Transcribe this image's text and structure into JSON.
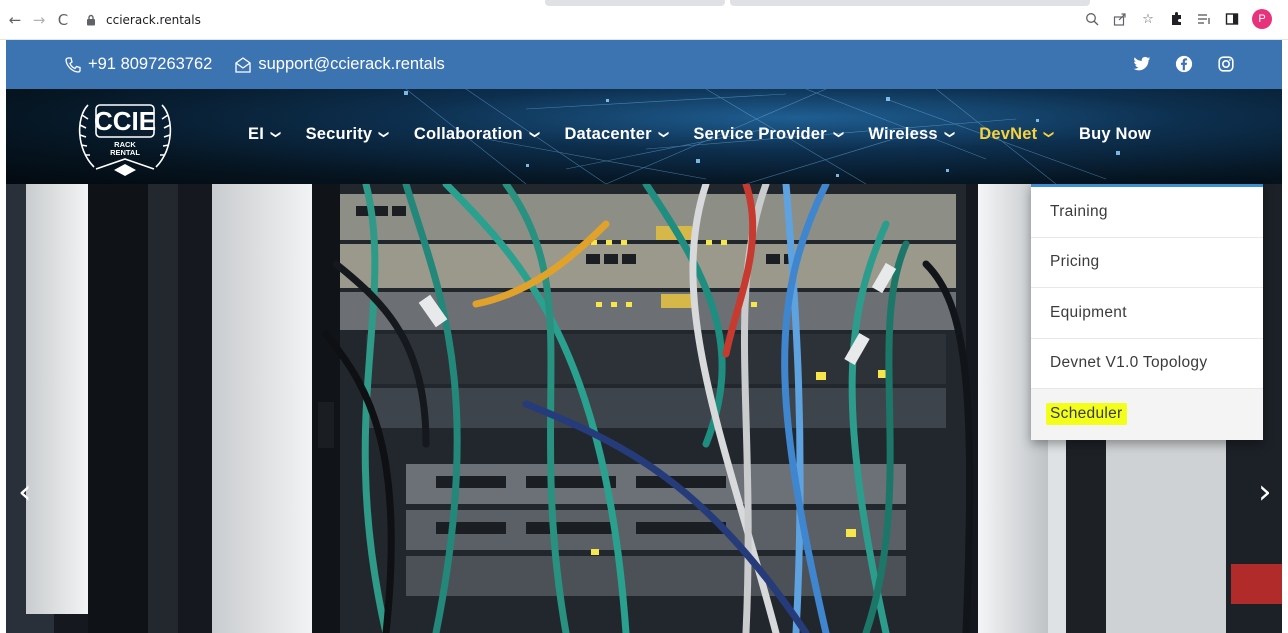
{
  "browser": {
    "url": "ccierack.rentals",
    "profile_initial": "P"
  },
  "topbar": {
    "phone": "+91 8097263762",
    "email": "support@ccierack.rentals",
    "social_icons": [
      "twitter-icon",
      "facebook-icon",
      "instagram-icon"
    ]
  },
  "logo": {
    "main": "CCIE",
    "sub1": "RACK",
    "sub2": "RENTAL"
  },
  "nav": {
    "items": [
      {
        "label": "EI",
        "has_dropdown": true
      },
      {
        "label": "Security",
        "has_dropdown": true
      },
      {
        "label": "Collaboration",
        "has_dropdown": true
      },
      {
        "label": "Datacenter",
        "has_dropdown": true
      },
      {
        "label": "Service Provider",
        "has_dropdown": true
      },
      {
        "label": "Wireless",
        "has_dropdown": true
      },
      {
        "label": "DevNet",
        "has_dropdown": true,
        "active": true
      },
      {
        "label": "Buy Now",
        "has_dropdown": false
      }
    ]
  },
  "dropdown": {
    "items": [
      "Training",
      "Pricing",
      "Equipment",
      "Devnet V1.0 Topology",
      "Scheduler"
    ],
    "highlighted": "Scheduler"
  },
  "colors": {
    "topbar": "#3c73b1",
    "active_nav": "#f6d23d",
    "highlight": "#f3ff1a",
    "dropdown_border": "#3c8fd0"
  }
}
